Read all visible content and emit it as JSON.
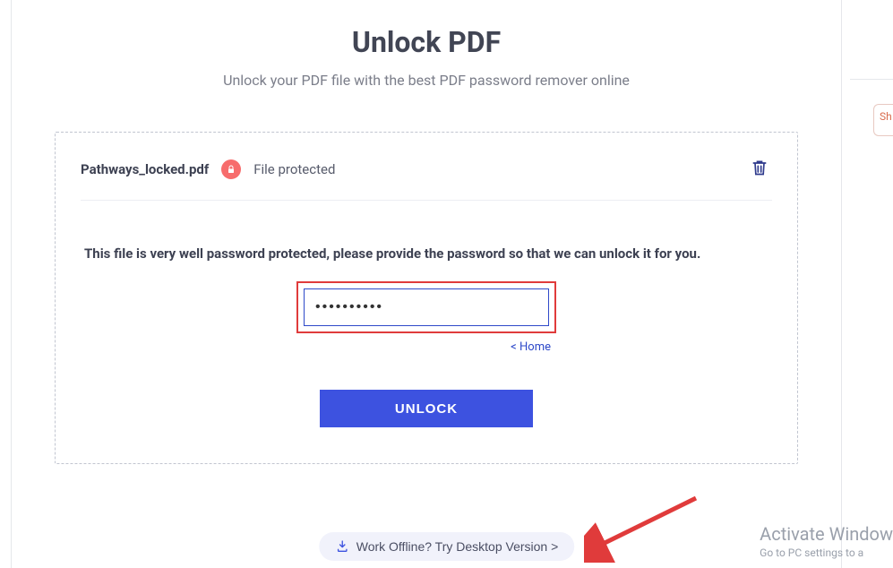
{
  "header": {
    "title": "Unlock PDF",
    "subtitle": "Unlock your PDF file with the best PDF password remover online"
  },
  "file": {
    "name": "Pathways_locked.pdf",
    "status": "File protected"
  },
  "body": {
    "instruction": "This file is very well password protected, please provide the password so that we can unlock it for you.",
    "password_value": "••••••••••",
    "home_link": "< Home",
    "unlock_label": "UNLOCK"
  },
  "footer": {
    "offline_label": "Work Offline? Try Desktop Version >"
  },
  "side": {
    "share_label": "Sh"
  },
  "watermark": {
    "line1": "Activate Window",
    "line2": "Go to PC settings to a"
  }
}
